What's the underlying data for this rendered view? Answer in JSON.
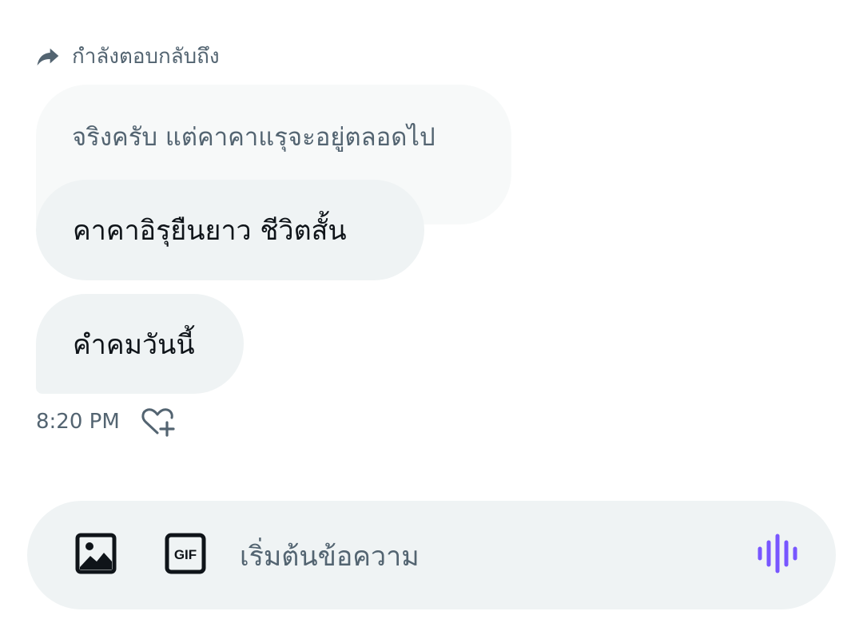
{
  "reply_header": {
    "label": "กำลังตอบกลับถึง",
    "icon": "reply-arrow-icon"
  },
  "quoted_message": {
    "text": "จริงครับ แต่คาคาแรุจะอยู่ตลอดไป"
  },
  "messages": [
    {
      "text": "คาคาอิรุยืนยาว ชีวิตสั้น"
    },
    {
      "text": "คำคมวันนี้"
    }
  ],
  "meta": {
    "timestamp": "8:20 PM",
    "react_icon": "heart-add-icon"
  },
  "composer": {
    "placeholder": "เริ่มต้นข้อความ",
    "value": "",
    "image_icon": "image-icon",
    "gif_icon": "gif-icon",
    "gif_label": "GIF",
    "voice_icon": "voice-wave-icon"
  },
  "colors": {
    "secondary_text": "#536471",
    "primary_text": "#0f1419",
    "bubble_bg": "#eff3f4",
    "quoted_bg": "#f7f9f9",
    "accent_voice": "#7856ff"
  }
}
